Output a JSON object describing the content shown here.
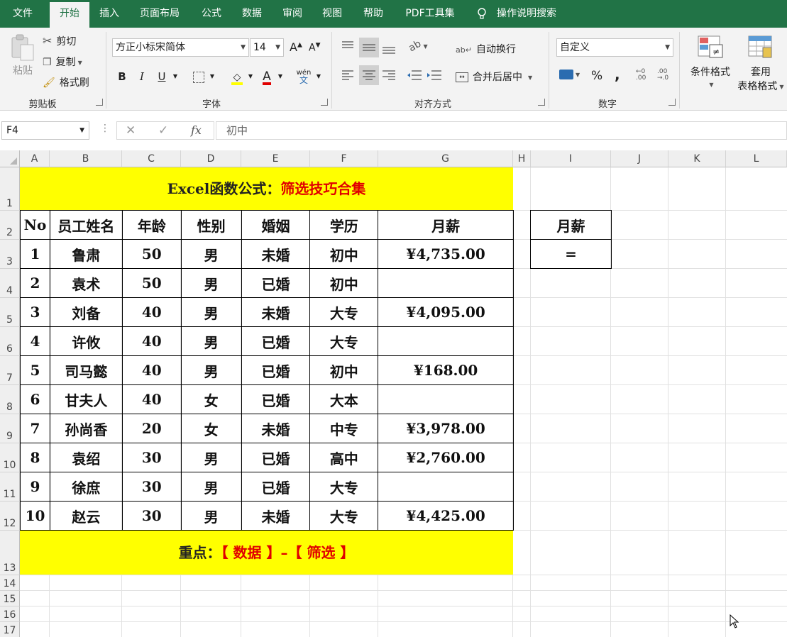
{
  "ribbon_tabs": [
    "文件",
    "开始",
    "插入",
    "页面布局",
    "公式",
    "数据",
    "审阅",
    "视图",
    "帮助",
    "PDF工具集"
  ],
  "active_tab": "开始",
  "tell_me": "操作说明搜索",
  "clipboard": {
    "paste": "粘贴",
    "cut": "剪切",
    "copy": "复制",
    "format_painter": "格式刷",
    "label": "剪贴板"
  },
  "font": {
    "name": "方正小标宋简体",
    "size": "14",
    "bold": "B",
    "italic": "I",
    "underline": "U",
    "phonetic": "wén",
    "phonetic_char": "文",
    "label": "字体"
  },
  "alignment": {
    "wrap_text": "自动换行",
    "merge_center": "合并后居中",
    "label": "对齐方式"
  },
  "number": {
    "format": "自定义",
    "percent": "%",
    "comma": ",",
    "label": "数字"
  },
  "styles": {
    "conditional": "条件格式",
    "table_format_1": "套用",
    "table_format_2": "表格格式"
  },
  "formula_bar": {
    "name_box": "F4",
    "fx": "fx",
    "content": "初中"
  },
  "columns": [
    "A",
    "B",
    "C",
    "D",
    "E",
    "F",
    "G",
    "H",
    "I",
    "J",
    "K",
    "L"
  ],
  "rows": [
    "1",
    "2",
    "3",
    "4",
    "5",
    "6",
    "7",
    "8",
    "9",
    "10",
    "11",
    "12",
    "13",
    "14",
    "15",
    "16",
    "17"
  ],
  "title": {
    "black": "Excel函数公式：",
    "red": "筛选技巧合集"
  },
  "table": {
    "headers": [
      "No",
      "员工姓名",
      "年龄",
      "性别",
      "婚姻",
      "学历",
      "月薪"
    ],
    "rows": [
      [
        "1",
        "鲁肃",
        "50",
        "男",
        "未婚",
        "初中",
        "¥4,735.00"
      ],
      [
        "2",
        "袁术",
        "50",
        "男",
        "已婚",
        "初中",
        ""
      ],
      [
        "3",
        "刘备",
        "40",
        "男",
        "未婚",
        "大专",
        "¥4,095.00"
      ],
      [
        "4",
        "许攸",
        "40",
        "男",
        "已婚",
        "大专",
        ""
      ],
      [
        "5",
        "司马懿",
        "40",
        "男",
        "已婚",
        "初中",
        "¥168.00"
      ],
      [
        "6",
        "甘夫人",
        "40",
        "女",
        "已婚",
        "大本",
        ""
      ],
      [
        "7",
        "孙尚香",
        "20",
        "女",
        "未婚",
        "中专",
        "¥3,978.00"
      ],
      [
        "8",
        "袁绍",
        "30",
        "男",
        "已婚",
        "高中",
        "¥2,760.00"
      ],
      [
        "9",
        "徐庶",
        "30",
        "男",
        "已婚",
        "大专",
        ""
      ],
      [
        "10",
        "赵云",
        "30",
        "男",
        "未婚",
        "大专",
        "¥4,425.00"
      ]
    ]
  },
  "criteria": {
    "header": "月薪",
    "value": "="
  },
  "footer": {
    "black": "重点：",
    "red": "【 数据 】–【 筛选 】"
  }
}
